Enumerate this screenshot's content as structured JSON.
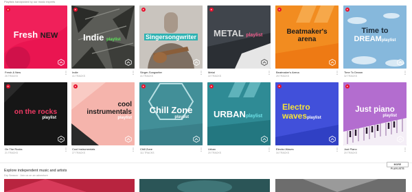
{
  "header": {
    "subtitle": "Playlists handpicked by our music experts"
  },
  "colors": {
    "accent": "#e8112d"
  },
  "playlists": [
    {
      "title": "Fresh & New",
      "count": "26 TRACKS",
      "cover_main": "Fresh",
      "cover_second": "NEW"
    },
    {
      "title": "Indie",
      "count": "41 TRACKS",
      "cover_main": "Indie",
      "cover_suffix": "playlist"
    },
    {
      "title": "Singer-Songwriter",
      "count": "41 TRACKS",
      "cover_main": "Singersongwriter"
    },
    {
      "title": "Metal",
      "count": "22 TRACKS",
      "cover_main": "METAL",
      "cover_suffix": "playlist"
    },
    {
      "title": "Beatmaker's Arena",
      "count": "25 TRACKS",
      "cover_main": "Beatmaker's",
      "cover_second": "arena"
    },
    {
      "title": "Time To Dream",
      "count": "32 TRACKS",
      "cover_main": "Time to",
      "cover_second": "DREAM",
      "cover_suffix": "playlist"
    },
    {
      "title": "On The Rocks",
      "count": "21 TRACKS",
      "cover_main": "on the rocks",
      "cover_suffix": "playlist"
    },
    {
      "title": "Cool Instrumentals",
      "count": "27 TRACKS",
      "cover_main": "cool",
      "cover_second": "instrumentals",
      "cover_suffix": "playlist"
    },
    {
      "title": "Chill Zone",
      "count": "111 TRACKS",
      "cover_main": "Chill Zone",
      "cover_suffix": "playlist"
    },
    {
      "title": "Urban",
      "count": "20 TRACKS",
      "cover_main": "URBAN",
      "cover_suffix": "playlist"
    },
    {
      "title": "Electro Waves",
      "count": "34 TRACKS",
      "cover_main": "Electro",
      "cover_second": "waves",
      "cover_suffix": "playlist"
    },
    {
      "title": "Just Piano",
      "count": "20 TRACKS",
      "cover_main": "Just piano",
      "cover_suffix": "playlist"
    }
  ],
  "more_button": "MORE PLAYLISTS",
  "explore": {
    "title": "Explore independent music and artists",
    "subtitle": "Dry Season · Join us on an adventure"
  },
  "icons": {
    "play": "play-icon",
    "badge": "brand-badge-icon",
    "more": "more-options-icon"
  }
}
